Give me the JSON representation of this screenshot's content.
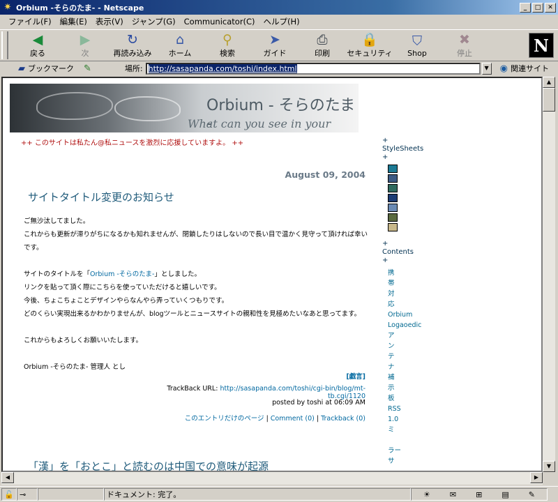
{
  "window": {
    "title": "Orbium -そらのたま- - Netscape",
    "min": "_",
    "max": "□",
    "close": "✕"
  },
  "menu": [
    "ファイル(F)",
    "編集(E)",
    "表示(V)",
    "ジャンプ(G)",
    "Communicator(C)",
    "ヘルプ(H)"
  ],
  "toolbar": [
    {
      "label": "戻る",
      "icon": "◀",
      "enabled": true
    },
    {
      "label": "次",
      "icon": "▶",
      "enabled": false
    },
    {
      "label": "再読み込み",
      "icon": "↻",
      "enabled": true
    },
    {
      "label": "ホーム",
      "icon": "⌂",
      "enabled": true
    },
    {
      "label": "検索",
      "icon": "⚲",
      "enabled": true
    },
    {
      "label": "ガイド",
      "icon": "➤",
      "enabled": true
    },
    {
      "label": "印刷",
      "icon": "⎙",
      "enabled": true
    },
    {
      "label": "セキュリティ",
      "icon": "🔒",
      "enabled": true
    },
    {
      "label": "Shop",
      "icon": "⛉",
      "enabled": true
    },
    {
      "label": "停止",
      "icon": "✖",
      "enabled": false
    }
  ],
  "brand_logo": "N",
  "location": {
    "bookmark_label": "ブックマーク",
    "loc_label": "場所:",
    "url": "http://sasapanda.com/toshi/index.html",
    "related": "関連サイト"
  },
  "page": {
    "banner_title": "Orbium - そらのたま -",
    "banner_subtitle": "What can you see in your mind?",
    "support": "++ このサイトは私たん@私ニュースを激烈に応援していますよ。 ++",
    "date": "August 09, 2004",
    "entry_title": "サイトタイトル変更のお知らせ",
    "p1": "ご無沙汰してました。",
    "p2": "これからも更新が滞りがちになるかも知れませんが、閉鎖したりはしないので長い目で温かく見守って頂ければ幸いです。",
    "p3a": "サイトのタイトルを「",
    "p3link": "Orbium -そらのたま-",
    "p3b": "」としました。",
    "p4": "リンクを貼って頂く際にこちらを使っていただけると嬉しいです。",
    "p5": "今後、ちょこちょことデザインやらなんやら弄っていくつもりです。",
    "p6": "どのくらい実現出来るかわかりませんが、blogツールとニュースサイトの親和性を見極めたいなあと思ってます。",
    "p7": "これからもよろしくお願いいたします。",
    "p8": "Orbium -そらのたま- 管理人 とし",
    "comment_link": "[戯言]",
    "trackback_label": "TrackBack URL:",
    "trackback_url": "http://sasapanda.com/toshi/cgi-bin/blog/mt-tb.cgi/1120",
    "posted": "posted by toshi at 06:09 AM",
    "this_entry": "このエントリだけのページ",
    "comment_count": "Comment (0)",
    "trackback_count": "Trackback (0)",
    "entry2_title": "「漢」を「おとこ」と読むのは中国での意味が起源"
  },
  "sidebar": {
    "plus": "+",
    "stylesheets": "StyleSheets",
    "swatches": [
      "#1c7a94",
      "#3c5a84",
      "#2f6a5e",
      "#1c3c74",
      "#6a8ab4",
      "#5a6a40",
      "#c8b88a"
    ],
    "contents": "Contents",
    "items": [
      "携",
      "帯",
      "対",
      "応",
      "Orbium",
      "Logaoedic",
      "ア",
      "ン",
      "テ",
      "ナ",
      "補",
      "示",
      "板",
      "RSS",
      "1.0",
      "ミ",
      "",
      "ラー",
      "サ"
    ]
  },
  "status": {
    "text": "ドキュメント: 完了。"
  }
}
